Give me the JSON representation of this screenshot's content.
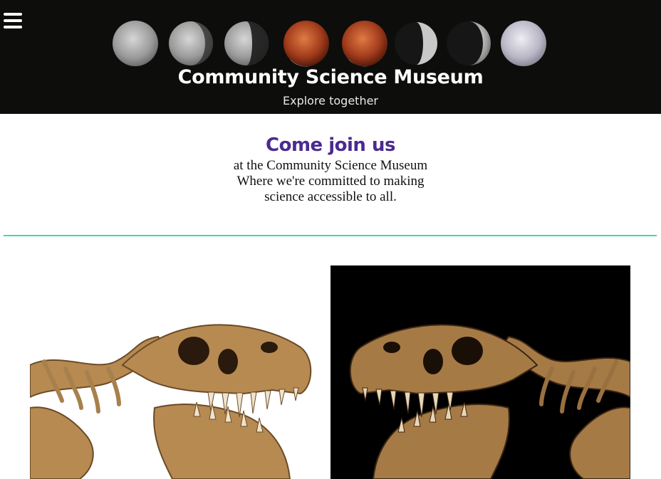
{
  "header": {
    "title": "Community Science Museum",
    "tagline": "Explore together",
    "menu_icon": "hamburger-menu-icon",
    "background_color": "#0d0d0b"
  },
  "intro": {
    "heading": "Come join us",
    "lines": [
      "at the Community Science Museum",
      "Where we're committed to making",
      "science accessible to all."
    ],
    "heading_color": "#4b2a8f"
  },
  "divider": {
    "color": "#3fd9b4"
  },
  "gallery": {
    "images": [
      {
        "name": "t-rex skull on white background",
        "background": "#ffffff"
      },
      {
        "name": "t-rex skull on black background",
        "background": "#000000"
      }
    ]
  }
}
